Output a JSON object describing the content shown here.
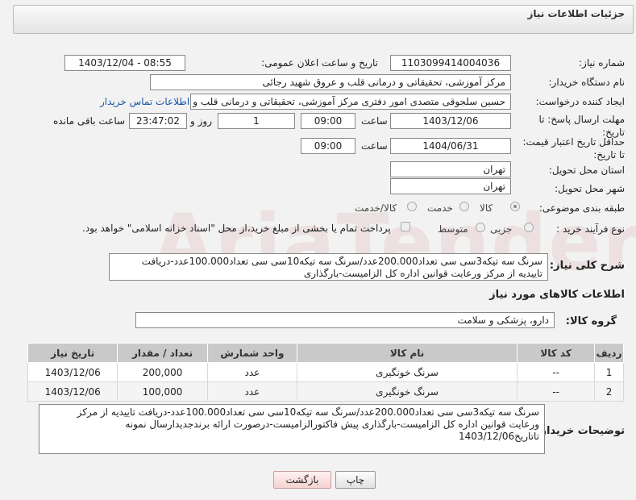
{
  "header": {
    "title": "جزئیات اطلاعات نیاز"
  },
  "fields": {
    "need_number_label": "شماره نیاز:",
    "need_number": "1103099414004036",
    "announce_label": "تاریخ و ساعت اعلان عمومی:",
    "announce_value": "1403/12/04 - 08:55",
    "buyer_org_label": "نام دستگاه خریدار:",
    "buyer_org": "مرکز آموزشی، تحقیقاتی و درمانی قلب و عروق شهید رجائی",
    "requester_label": "ایجاد کننده درخواست:",
    "requester": "حسین سلجوقی متصدی امور دفتری مرکز آموزشی، تحقیقاتی و درمانی قلب و ع",
    "contact_link": "اطلاعات تماس خریدار",
    "deadline_label": "مهلت ارسال پاسخ: تا تاریخ:",
    "deadline_date": "1403/12/06",
    "hour_label": "ساعت",
    "deadline_time": "09:00",
    "days_value": "1",
    "days_label": "روز و",
    "remaining_time": "23:47:02",
    "remaining_label": "ساعت باقی مانده",
    "validity_label": "حداقل تاریخ اعتبار قیمت: تا تاریخ:",
    "validity_date": "1404/06/31",
    "validity_time": "09:00",
    "province_label": "استان محل تحویل:",
    "province": "تهران",
    "city_label": "شهر محل تحویل:",
    "city": "تهران",
    "category_label": "طبقه بندی موضوعی:",
    "category_options": [
      "کالا",
      "خدمت",
      "کالا/خدمت"
    ],
    "process_label": "نوع فرآیند خرید :",
    "process_options": [
      "جزیی",
      "متوسط"
    ],
    "payment_note": "پرداخت تمام یا بخشی از مبلغ خرید،از محل \"اسناد خزانه اسلامی\" خواهد بود."
  },
  "summary": {
    "label": "شرح کلی نیاز:",
    "text": "سرنگ سه تیکه3سی سی تعداد200.000عدد/سرنگ سه تیکه10سی سی تعداد100.000عدد-دریافت تاییدیه از مرکز ورعایت قوانین اداره کل الزامیست-بارگذاری"
  },
  "goods": {
    "section_title": "اطلاعات کالاهای مورد نیاز",
    "group_label": "گروه کالا:",
    "group_value": "دارو، پزشکی و سلامت",
    "columns": [
      "ردیف",
      "کد کالا",
      "نام کالا",
      "واحد شمارش",
      "تعداد / مقدار",
      "تاریخ نیاز"
    ],
    "rows": [
      [
        "1",
        "--",
        "سرنگ خونگیری",
        "عدد",
        "200,000",
        "1403/12/06"
      ],
      [
        "2",
        "--",
        "سرنگ خونگیری",
        "عدد",
        "100,000",
        "1403/12/06"
      ]
    ]
  },
  "buyer_notes": {
    "label": "توضیحات خریدار:",
    "text": "سرنگ سه تیکه3سی سی تعداد200.000عدد/سرنگ سه تیکه10سی سی تعداد100.000عدد-دریافت تاییدیه از مرکز ورعایت قوانین اداره کل الزامیست-بارگذاری پیش فاکتورالزامیست-درصورت ارائه برندجدیدارسال نمونه تاتاریخ1403/12/06"
  },
  "buttons": {
    "print": "چاپ",
    "back": "بازگشت"
  },
  "watermark": "AriaTender.neT"
}
